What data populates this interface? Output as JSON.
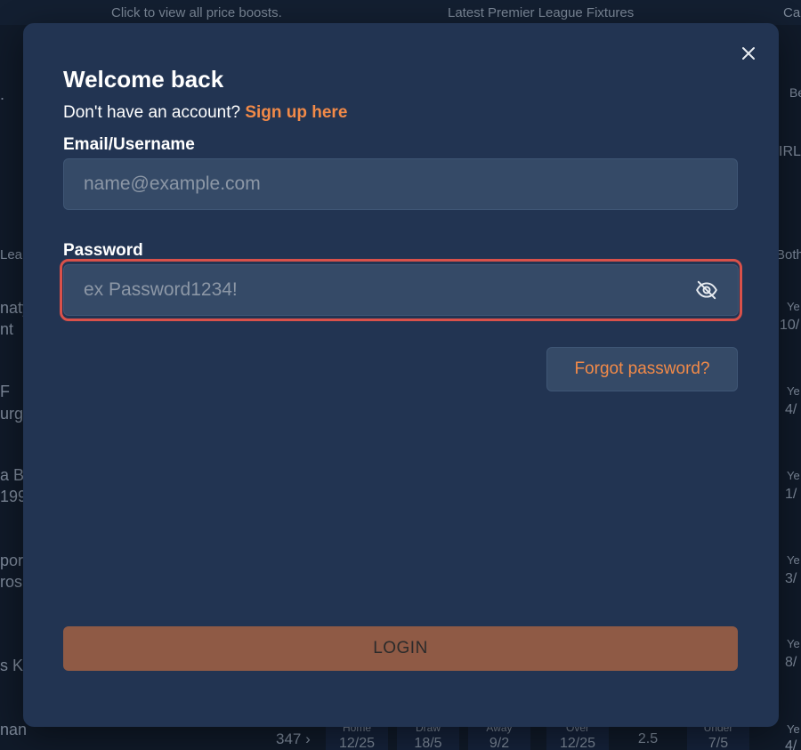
{
  "background": {
    "top_bar": [
      "Click to view all price boosts.",
      "Latest Premier League Fixtures",
      "Ca"
    ],
    "left_fragments": [
      ".",
      "Lea",
      "naty",
      "nt",
      "F",
      "urg",
      "a B",
      "199",
      "por",
      "ros",
      "s K",
      "nan"
    ],
    "right_fragments": [
      "Be",
      "IRL",
      "Both",
      "Ye",
      "10/",
      "Ye",
      "4/",
      "Ye",
      "1/",
      "Ye",
      "3/",
      "Ye",
      "8/",
      "Ye",
      "4/"
    ],
    "bottom_row": {
      "count": "347",
      "cells": [
        {
          "label": "Home",
          "value": "12/25"
        },
        {
          "label": "Draw",
          "value": "18/5"
        },
        {
          "label": "Away",
          "value": "9/2"
        },
        {
          "label": "Over",
          "value": "12/25"
        },
        {
          "label": "",
          "value": "2.5"
        },
        {
          "label": "Under",
          "value": "7/5"
        }
      ]
    }
  },
  "modal": {
    "title": "Welcome back",
    "signup_prompt": "Don't have an account?",
    "signup_link": "Sign up here",
    "email_label": "Email/Username",
    "email_placeholder": "name@example.com",
    "password_label": "Password",
    "password_placeholder": "ex Password1234!",
    "forgot_label": "Forgot password?",
    "login_label": "LOGIN",
    "icons": {
      "close": "close-icon",
      "toggle_visibility": "eye-off-icon"
    },
    "colors": {
      "accent": "#f28a48",
      "modal_bg": "#223452",
      "input_bg": "#354a67",
      "focus_border": "#d9514a",
      "login_bg": "#8f5a45"
    }
  }
}
